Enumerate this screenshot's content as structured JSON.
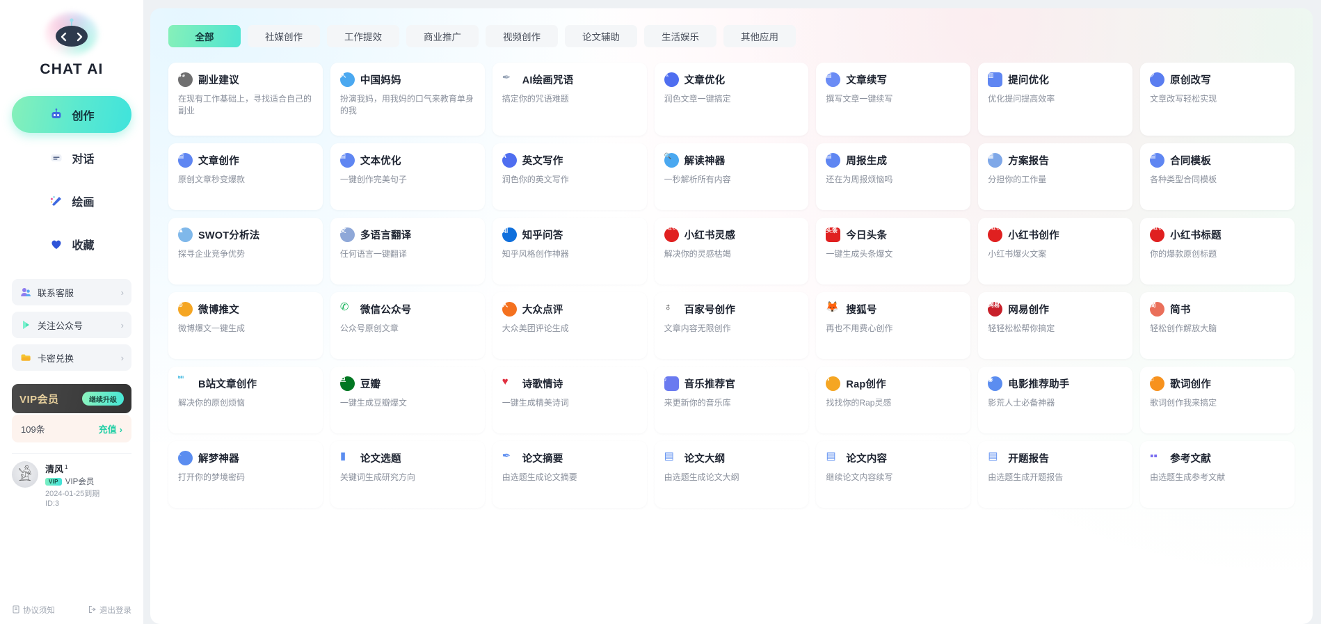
{
  "brand": {
    "title": "CHAT AI",
    "logo_icon": "robot-logo-icon"
  },
  "sidebar": {
    "nav": [
      {
        "label": "创作",
        "icon": "robot-icon",
        "active": true
      },
      {
        "label": "对话",
        "icon": "chat-bubble-icon",
        "active": false
      },
      {
        "label": "绘画",
        "icon": "paint-brush-icon",
        "active": false
      },
      {
        "label": "收藏",
        "icon": "heart-icon",
        "active": false
      }
    ],
    "quick_links": [
      {
        "label": "联系客服",
        "icon": "customer-service-icon",
        "chevron": "›"
      },
      {
        "label": "关注公众号",
        "icon": "play-triangle-icon",
        "chevron": "›"
      },
      {
        "label": "卡密兑换",
        "icon": "wallet-icon",
        "chevron": "›"
      }
    ],
    "vip": {
      "label": "VIP会员",
      "button": "继续升级"
    },
    "credit": {
      "count": "109条",
      "link": "充值",
      "chevron": "›"
    },
    "user": {
      "name": "清风",
      "level_sup": "1",
      "vip_badge": "VIP",
      "vip_text": "VIP会员",
      "expiry": "2024-01-25到期",
      "id": "ID:3"
    },
    "footer": [
      {
        "label": "协议须知",
        "icon": "document-icon"
      },
      {
        "label": "退出登录",
        "icon": "logout-icon"
      }
    ]
  },
  "main": {
    "tabs": [
      {
        "label": "全部",
        "active": true
      },
      {
        "label": "社媒创作",
        "active": false
      },
      {
        "label": "工作提效",
        "active": false
      },
      {
        "label": "商业推广",
        "active": false
      },
      {
        "label": "视频创作",
        "active": false
      },
      {
        "label": "论文辅助",
        "active": false
      },
      {
        "label": "生活娱乐",
        "active": false
      },
      {
        "label": "其他应用",
        "active": false
      }
    ],
    "cards": [
      {
        "title": "副业建议",
        "desc": "在现有工作基础上，寻找适合自己的副业",
        "icon": "panda-icon",
        "color": "#6f6f70",
        "glyph": "◕◕",
        "shape": "circle"
      },
      {
        "title": "中国妈妈",
        "desc": "扮演我妈，用我妈的口气来教育单身的我",
        "icon": "person-blue-icon",
        "color": "#4aa8f0",
        "glyph": "人",
        "shape": "circle"
      },
      {
        "title": "AI绘画咒语",
        "desc": "搞定你的咒语难题",
        "icon": "feather-pen-icon",
        "color": "#9aa6b8",
        "glyph": "✒",
        "shape": "none"
      },
      {
        "title": "文章优化",
        "desc": "润色文章一键搞定",
        "icon": "pencil-doc-icon",
        "color": "#4f6ef0",
        "glyph": "✎",
        "shape": "circle"
      },
      {
        "title": "文章续写",
        "desc": "撰写文章一键续写",
        "icon": "doc-check-icon",
        "color": "#6b8cf5",
        "glyph": "▤",
        "shape": "circle"
      },
      {
        "title": "提问优化",
        "desc": "优化提问提高效率",
        "icon": "doc-question-icon",
        "color": "#5f86f2",
        "glyph": "▥",
        "shape": "sq"
      },
      {
        "title": "原创改写",
        "desc": "文章改写轻松实现",
        "icon": "rewrite-icon",
        "color": "#5a7df0",
        "glyph": "✐",
        "shape": "circle"
      },
      {
        "title": "文章创作",
        "desc": "原创文章秒变爆款",
        "icon": "doc-pen-icon",
        "color": "#5f86f2",
        "glyph": "▤",
        "shape": "circle"
      },
      {
        "title": "文本优化",
        "desc": "一键创作完美句子",
        "icon": "doc-edit-icon",
        "color": "#5f86f2",
        "glyph": "▤",
        "shape": "circle"
      },
      {
        "title": "英文写作",
        "desc": "润色你的英文写作",
        "icon": "letter-a-icon",
        "color": "#4f6ef0",
        "glyph": "A",
        "shape": "circle"
      },
      {
        "title": "解读神器",
        "desc": "一秒解析所有内容",
        "icon": "magnify-doc-icon",
        "color": "#4aa8f0",
        "glyph": "🔍",
        "shape": "circle"
      },
      {
        "title": "周报生成",
        "desc": "还在为周报烦恼吗",
        "icon": "report-icon",
        "color": "#5f86f2",
        "glyph": "▤",
        "shape": "circle"
      },
      {
        "title": "方案报告",
        "desc": "分担你的工作量",
        "icon": "presentation-icon",
        "color": "#7fa8e8",
        "glyph": "▦",
        "shape": "circle"
      },
      {
        "title": "合同模板",
        "desc": "各种类型合同模板",
        "icon": "contract-icon",
        "color": "#5f86f2",
        "glyph": "▤",
        "shape": "circle"
      },
      {
        "title": "SWOT分析法",
        "desc": "探寻企业竞争优势",
        "icon": "chart-analysis-icon",
        "color": "#7fb8ea",
        "glyph": "▲",
        "shape": "circle"
      },
      {
        "title": "多语言翻译",
        "desc": "任何语言一键翻译",
        "icon": "translate-icon",
        "color": "#8fa8d8",
        "glyph": "文",
        "shape": "circle"
      },
      {
        "title": "知乎问答",
        "desc": "知乎风格创作神器",
        "icon": "zhihu-icon",
        "color": "#0f6fdc",
        "glyph": "知",
        "shape": "circle"
      },
      {
        "title": "小红书灵感",
        "desc": "解决你的灵感枯竭",
        "icon": "xiaohongshu-icon",
        "color": "#e02020",
        "glyph": "小红书",
        "shape": "circle"
      },
      {
        "title": "今日头条",
        "desc": "一键生成头条爆文",
        "icon": "toutiao-icon",
        "color": "#e02020",
        "glyph": "头条",
        "shape": "sq"
      },
      {
        "title": "小红书创作",
        "desc": "小红书爆火文案",
        "icon": "xiaohongshu-icon",
        "color": "#e02020",
        "glyph": "小红书",
        "shape": "circle"
      },
      {
        "title": "小红书标题",
        "desc": "你的爆款原创标题",
        "icon": "xiaohongshu-icon",
        "color": "#e02020",
        "glyph": "小红书",
        "shape": "circle"
      },
      {
        "title": "微博推文",
        "desc": "微博爆文一键生成",
        "icon": "weibo-icon",
        "color": "#f5a623",
        "glyph": "⊙",
        "shape": "circle"
      },
      {
        "title": "微信公众号",
        "desc": "公众号原创文章",
        "icon": "wechat-icon",
        "color": "#16b45a",
        "glyph": "✆",
        "shape": "none"
      },
      {
        "title": "大众点评",
        "desc": "大众美团评论生成",
        "icon": "dianping-icon",
        "color": "#f4711f",
        "glyph": "人",
        "shape": "circle"
      },
      {
        "title": "百家号创作",
        "desc": "文章内容无限创作",
        "icon": "baijiahao-icon",
        "color": "#2b2b2b",
        "glyph": "♁",
        "shape": "none"
      },
      {
        "title": "搜狐号",
        "desc": "再也不用费心创作",
        "icon": "sohu-icon",
        "color": "#f2b705",
        "glyph": "🦊",
        "shape": "none"
      },
      {
        "title": "网易创作",
        "desc": "轻轻松松帮你搞定",
        "icon": "netease-icon",
        "color": "#c8202a",
        "glyph": "网易",
        "shape": "circle"
      },
      {
        "title": "简书",
        "desc": "轻松创作解放大脑",
        "icon": "jianshu-icon",
        "color": "#ea6f5a",
        "glyph": "简",
        "shape": "circle"
      },
      {
        "title": "B站文章创作",
        "desc": "解决你的原创烦恼",
        "icon": "bilibili-icon",
        "color": "#00a1d6",
        "glyph": "bili",
        "shape": "none"
      },
      {
        "title": "豆瓣",
        "desc": "一键生成豆瓣爆文",
        "icon": "douban-icon",
        "color": "#007722",
        "glyph": "豆",
        "shape": "circle"
      },
      {
        "title": "诗歌情诗",
        "desc": "一键生成精美诗词",
        "icon": "heart-red-icon",
        "color": "#e03040",
        "glyph": "♥",
        "shape": "none"
      },
      {
        "title": "音乐推荐官",
        "desc": "来更新你的音乐库",
        "icon": "music-note-icon",
        "color": "#6a7af0",
        "glyph": "♪",
        "shape": "sq"
      },
      {
        "title": "Rap创作",
        "desc": "找找你的Rap灵感",
        "icon": "microphone-icon",
        "color": "#f5a623",
        "glyph": "◑",
        "shape": "circle"
      },
      {
        "title": "电影推荐助手",
        "desc": "影荒人士必备神器",
        "icon": "film-reel-icon",
        "color": "#5b8df0",
        "glyph": "◉",
        "shape": "circle"
      },
      {
        "title": "歌词创作",
        "desc": "歌词创作我来搞定",
        "icon": "lyrics-icon",
        "color": "#f7921e",
        "glyph": "♫",
        "shape": "circle"
      },
      {
        "title": "解梦神器",
        "desc": "打开你的梦境密码",
        "icon": "dream-lock-icon",
        "color": "#5b8df0",
        "glyph": "☾",
        "shape": "circle"
      },
      {
        "title": "论文选题",
        "desc": "关键词生成研究方向",
        "icon": "book-blue-icon",
        "color": "#5b8df0",
        "glyph": "▮",
        "shape": "none"
      },
      {
        "title": "论文摘要",
        "desc": "由选题生成论文摘要",
        "icon": "pen-nib-icon",
        "color": "#5b8df0",
        "glyph": "✒",
        "shape": "none"
      },
      {
        "title": "论文大纲",
        "desc": "由选题生成论文大纲",
        "icon": "outline-icon",
        "color": "#5b8df0",
        "glyph": "▤",
        "shape": "none"
      },
      {
        "title": "论文内容",
        "desc": "继续论文内容续写",
        "icon": "doc-check-blue-icon",
        "color": "#5b8df0",
        "glyph": "▤",
        "shape": "none"
      },
      {
        "title": "开题报告",
        "desc": "由选题生成开题报告",
        "icon": "proposal-icon",
        "color": "#5b8df0",
        "glyph": "▤",
        "shape": "none"
      },
      {
        "title": "参考文献",
        "desc": "由选题生成参考文献",
        "icon": "reference-icon",
        "color": "#7b6ff0",
        "glyph": "▪▪",
        "shape": "none"
      }
    ]
  },
  "colors": {
    "accent_green": "#4ee5d2",
    "accent_mint": "#86f0b9",
    "sidebar_bg": "#ffffff",
    "page_bg": "#eef1f4",
    "vip_gold": "#e6cf9c"
  }
}
